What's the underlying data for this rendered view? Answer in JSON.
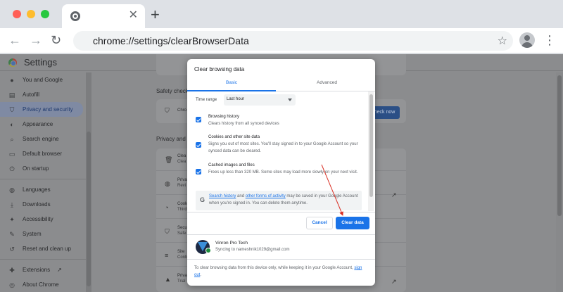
{
  "browser": {
    "tab_close": "✕",
    "new_tab": "+",
    "back": "←",
    "forward": "→",
    "reload": "↻",
    "url": "chrome://settings/clearBrowserData",
    "bookmark_star": "☆",
    "menu": "⋮"
  },
  "settings": {
    "title": "Settings",
    "sidebar": [
      {
        "label": "You and Google",
        "icon": "person-icon",
        "glyph": "●"
      },
      {
        "label": "Autofill",
        "icon": "autofill-icon",
        "glyph": "▤"
      },
      {
        "label": "Privacy and security",
        "icon": "shield-icon",
        "glyph": "⛉",
        "active": true
      },
      {
        "label": "Appearance",
        "icon": "palette-icon",
        "glyph": "◐"
      },
      {
        "label": "Search engine",
        "icon": "search-icon",
        "glyph": "⌕"
      },
      {
        "label": "Default browser",
        "icon": "browser-icon",
        "glyph": "▭"
      },
      {
        "label": "On startup",
        "icon": "power-icon",
        "glyph": "⏻"
      }
    ],
    "sidebar_advanced": [
      {
        "label": "Languages",
        "icon": "globe-icon",
        "glyph": "◍"
      },
      {
        "label": "Downloads",
        "icon": "download-icon",
        "glyph": "⤓"
      },
      {
        "label": "Accessibility",
        "icon": "accessibility-icon",
        "glyph": "✦"
      },
      {
        "label": "System",
        "icon": "wrench-icon",
        "glyph": "✎"
      },
      {
        "label": "Reset and clean up",
        "icon": "reset-icon",
        "glyph": "↺"
      }
    ],
    "sidebar_bottom": [
      {
        "label": "Extensions",
        "icon": "puzzle-icon",
        "glyph": "✚"
      },
      {
        "label": "About Chrome",
        "icon": "chrome-icon",
        "glyph": "◎"
      }
    ],
    "safety_check_label": "Safety check",
    "safety_row_text": "Chro",
    "check_now": "Check now",
    "privacy_label": "Privacy and s",
    "privacy_rows": [
      {
        "t1": "Clea",
        "t2": "Clea",
        "glyph": "🗑"
      },
      {
        "t1": "Priva",
        "t2": "Revi",
        "glyph": "◍"
      },
      {
        "t1": "Cook",
        "t2": "Third",
        "glyph": "◔"
      },
      {
        "t1": "Secu",
        "t2": "Safe",
        "glyph": "⛉"
      },
      {
        "t1": "Site",
        "t2": "Contr",
        "glyph": "≡"
      },
      {
        "t1": "Priva",
        "t2": "Trial",
        "glyph": "▲"
      }
    ]
  },
  "dialog": {
    "title": "Clear browsing data",
    "tab_basic": "Basic",
    "tab_advanced": "Advanced",
    "time_range_label": "Time range",
    "time_range_value": "Last hour",
    "options": [
      {
        "title": "Browsing history",
        "desc": "Clears history from all synced devices",
        "checked": true
      },
      {
        "title": "Cookies and other site data",
        "desc": "Signs you out of most sites. You'll stay signed in to your Google Account so your synced data can be cleared.",
        "checked": true
      },
      {
        "title": "Cached images and files",
        "desc": "Frees up less than 320 MB. Some sites may load more slowly on your next visit.",
        "checked": true
      }
    ],
    "google_notice": {
      "link1": "Search history",
      "and": " and ",
      "link2": "other forms of activity",
      "rest": " may be saved in your Google Account when you're signed in. You can delete them anytime."
    },
    "cancel": "Cancel",
    "clear": "Clear data",
    "account_name": "Vinron Pro Tech",
    "account_sync": "Syncing to nameshnik1029@gmail.com",
    "footer_text": "To clear browsing data from this device only, while keeping it in your Google Account, ",
    "footer_link": "sign out",
    "footer_end": "."
  },
  "colors": {
    "accent": "#1a73e8",
    "arrow": "#d93025"
  }
}
